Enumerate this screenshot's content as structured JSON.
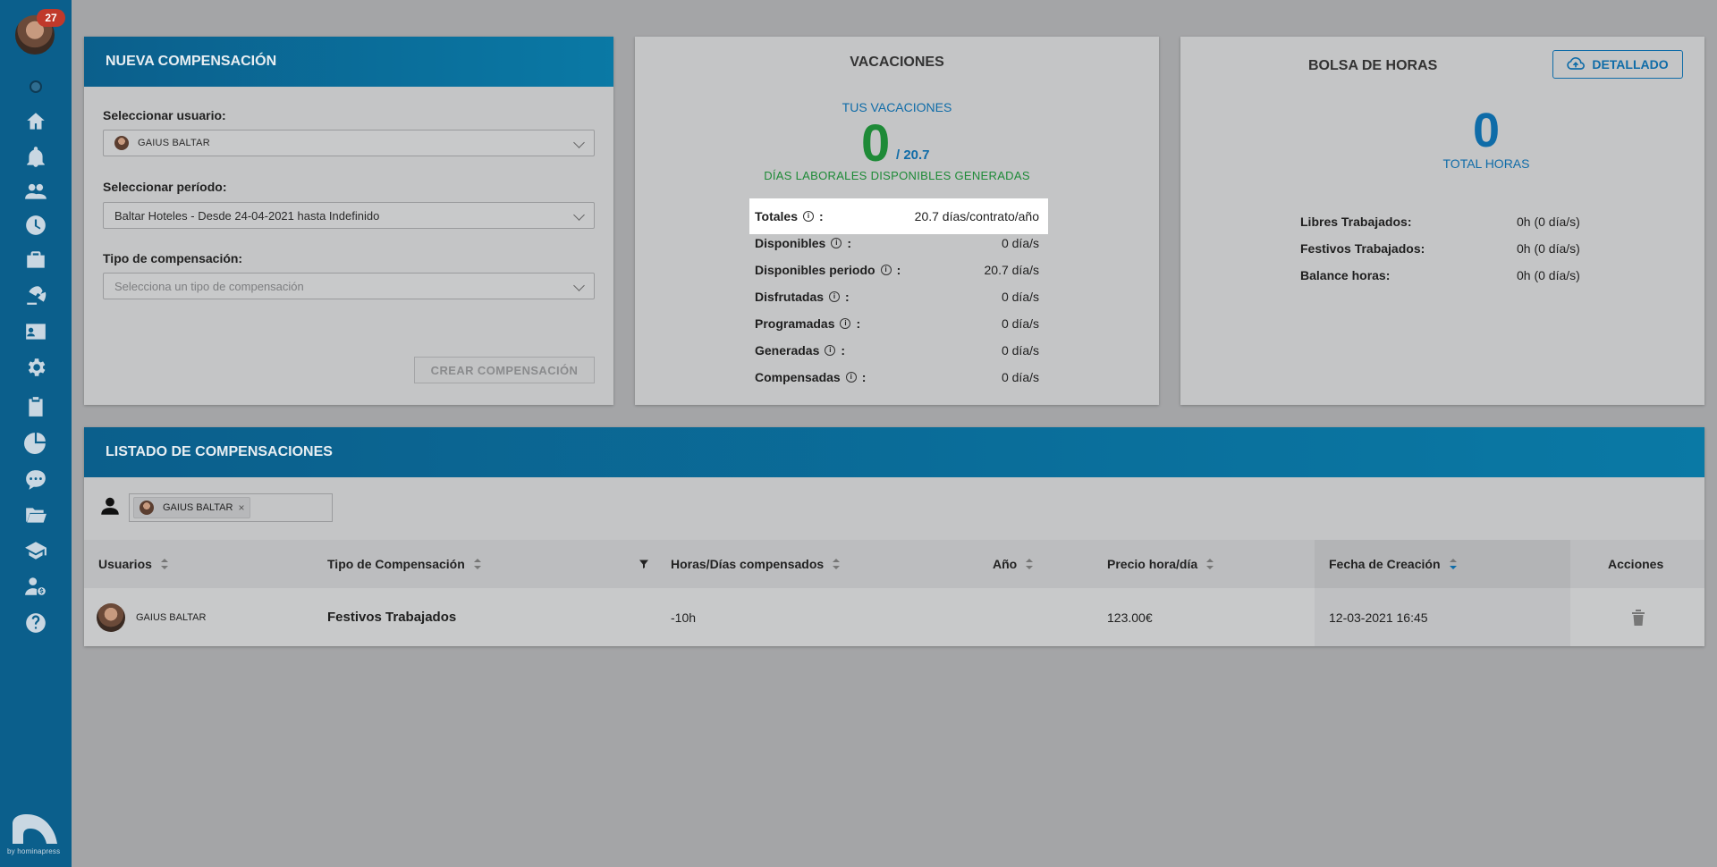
{
  "sidebar": {
    "notification_count": "27",
    "logo_text": "by hominapress",
    "icons": [
      "home-icon",
      "bell-icon",
      "users-icon",
      "clock-icon",
      "briefcase-icon",
      "beach-icon",
      "id-card-icon",
      "gear-icon",
      "clipboard-icon",
      "pie-chart-icon",
      "chat-icon",
      "folder-icon",
      "graduation-cap-icon",
      "user-money-icon",
      "help-icon"
    ]
  },
  "nueva": {
    "title": "NUEVA COMPENSACIÓN",
    "user_label": "Seleccionar usuario:",
    "user_value": "GAIUS BALTAR",
    "period_label": "Seleccionar período:",
    "period_value": "Baltar Hoteles - Desde 24-04-2021 hasta Indefinido",
    "type_label": "Tipo de compensación:",
    "type_placeholder": "Selecciona un tipo de compensación",
    "create_button": "CREAR COMPENSACIÓN"
  },
  "vacaciones": {
    "title": "VACACIONES",
    "subtitle": "TUS VACACIONES",
    "available": "0",
    "total": "/ 20.7",
    "generated_label": "DÍAS LABORALES DISPONIBLES GENERADAS",
    "rows": [
      {
        "label": "Totales",
        "value": "20.7 días/contrato/año"
      },
      {
        "label": "Disponibles",
        "value": "0 día/s"
      },
      {
        "label": "Disponibles periodo",
        "value": "20.7 día/s"
      },
      {
        "label": "Disfrutadas",
        "value": "0 día/s"
      },
      {
        "label": "Programadas",
        "value": "0 día/s"
      },
      {
        "label": "Generadas",
        "value": "0 día/s"
      },
      {
        "label": "Compensadas",
        "value": "0 día/s"
      }
    ]
  },
  "bolsa": {
    "title": "BOLSA DE HORAS",
    "detail_button": "DETALLADO",
    "total": "0",
    "total_label": "TOTAL HORAS",
    "rows": [
      {
        "label": "Libres Trabajados:",
        "value": "0h (0 día/s)"
      },
      {
        "label": "Festivos Trabajados:",
        "value": "0h (0 día/s)"
      },
      {
        "label": "Balance horas:",
        "value": "0h (0 día/s)"
      }
    ]
  },
  "listado": {
    "title": "LISTADO DE COMPENSACIONES",
    "filter_tag": "GAIUS BALTAR",
    "columns": [
      "Usuarios",
      "Tipo de Compensación",
      "Horas/Días compensados",
      "Año",
      "Precio hora/día",
      "Fecha de Creación",
      "Acciones"
    ],
    "rows": [
      {
        "user": "GAIUS BALTAR",
        "type": "Festivos Trabajados",
        "hours": "-10h",
        "year": "",
        "price": "123.00€",
        "created": "12-03-2021 16:45"
      }
    ]
  },
  "colors": {
    "sidebar": "#0b5f8c",
    "accent_blue": "#0f6ca8",
    "accent_green": "#1e8a37",
    "badge": "#c0392b"
  }
}
